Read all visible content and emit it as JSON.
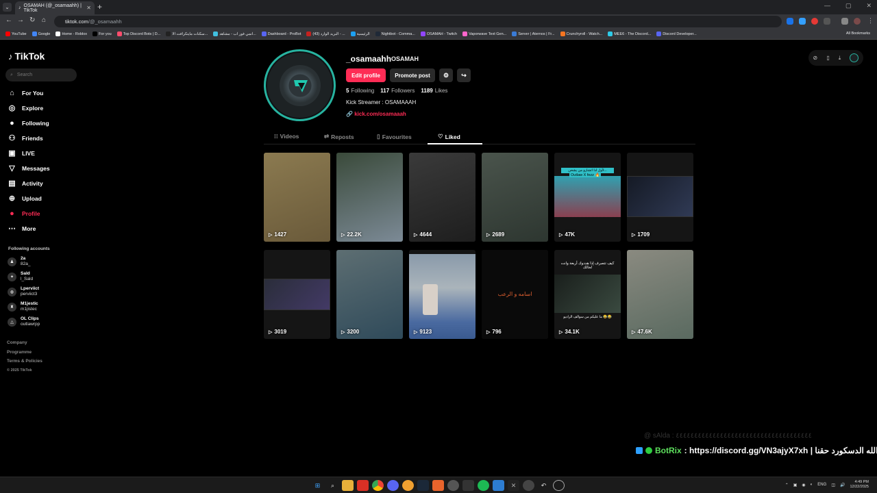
{
  "browser": {
    "tab_title": "OSAMAH (@_osamaahh) | TikTok",
    "url_host": "tiktok.com",
    "url_path": "/@_osamaahh",
    "bookmarks": [
      {
        "label": "YouTube",
        "color": "#ff0000"
      },
      {
        "label": "Google",
        "color": "#4285f4"
      },
      {
        "label": "Home - Roblox",
        "color": "#ffffff"
      },
      {
        "label": "For you",
        "color": "#000000"
      },
      {
        "label": "Top Discord Bots | D...",
        "color": "#ff4d6d"
      },
      {
        "label": "سكنات ماينكرافت الا...",
        "color": "#222222"
      },
      {
        "label": "انمي فور اب - مشاهد...",
        "color": "#41c0e0"
      },
      {
        "label": "Dashboard - ProBot",
        "color": "#5865f2"
      },
      {
        "label": "(43) البريد الوارد - ...",
        "color": "#c5221f"
      },
      {
        "label": "الرئيسية",
        "color": "#1da1f2"
      },
      {
        "label": "Nightbot - Comma...",
        "color": "#1f2937"
      },
      {
        "label": "OSAMAH - Twitch",
        "color": "#9146ff"
      },
      {
        "label": "Vaporwave Text Gen...",
        "color": "#ff66cc"
      },
      {
        "label": "Server | Aternos | Fr...",
        "color": "#3a7bd5"
      },
      {
        "label": "Crunchyroll - Watch...",
        "color": "#f47521"
      },
      {
        "label": "MEE6 - The Discord...",
        "color": "#2ecbe8"
      },
      {
        "label": "Discord Developer...",
        "color": "#5865f2"
      }
    ],
    "all_bookmarks": "All Bookmarks"
  },
  "sidebar": {
    "logo": "TikTok",
    "search_placeholder": "Search",
    "nav": [
      {
        "label": "For You",
        "icon": "home-icon"
      },
      {
        "label": "Explore",
        "icon": "compass-icon"
      },
      {
        "label": "Following",
        "icon": "following-avatar-icon"
      },
      {
        "label": "Friends",
        "icon": "friends-icon"
      },
      {
        "label": "LIVE",
        "icon": "live-icon"
      },
      {
        "label": "Messages",
        "icon": "messages-icon"
      },
      {
        "label": "Activity",
        "icon": "activity-icon"
      },
      {
        "label": "Upload",
        "icon": "upload-icon"
      },
      {
        "label": "Profile",
        "icon": "profile-icon"
      },
      {
        "label": "More",
        "icon": "more-icon"
      }
    ],
    "following_title": "Following accounts",
    "following": [
      {
        "name": "2a",
        "handle": "82a_"
      },
      {
        "name": "Sald",
        "handle": "l_Sald"
      },
      {
        "name": "Lperviict",
        "handle": "perviict3"
      },
      {
        "name": "M1jestic",
        "handle": "m1jistec"
      },
      {
        "name": "OL Clips",
        "handle": "outlawrpp"
      }
    ],
    "footer": [
      "Company",
      "Programme",
      "Terms & Policies",
      "© 2025 TikTok"
    ]
  },
  "profile": {
    "username": "_osamaahh",
    "nickname": "OSAMAH",
    "edit_label": "Edit profile",
    "promote_label": "Promote post",
    "following_count": "5",
    "following_label": "Following",
    "followers_count": "117",
    "followers_label": "Followers",
    "likes_count": "1189",
    "likes_label": "Likes",
    "bio": "Kick Streamer : OSAMAAAH",
    "link": "kick.com/osamaaah",
    "tabs": [
      "Videos",
      "Reposts",
      "Favourites",
      "Liked"
    ],
    "selected_tab": "Liked"
  },
  "videos": [
    {
      "views": "1427",
      "colors": [
        "#6a5a3a",
        "#8b7a50"
      ]
    },
    {
      "views": "22.2K",
      "colors": [
        "#7c8a96",
        "#3a4a3a"
      ]
    },
    {
      "views": "4644",
      "colors": [
        "#1e1e1e",
        "#3a3a3a"
      ]
    },
    {
      "views": "2689",
      "colors": [
        "#2d3630",
        "#4a544c"
      ]
    },
    {
      "views": "47K",
      "colors": [
        "#8a4050",
        "#30a0b0"
      ]
    },
    {
      "views": "1709",
      "colors": [
        "#151a25",
        "#303a55"
      ]
    },
    {
      "views": "3019",
      "colors": [
        "#2a2d3a",
        "#433a66"
      ]
    },
    {
      "views": "3200",
      "colors": [
        "#2f4a5a",
        "#5d6e72"
      ]
    },
    {
      "views": "9123",
      "colors": [
        "#6a7a8a",
        "#9aa6b0"
      ]
    },
    {
      "views": "796",
      "colors": [
        "#0a0a0a",
        "#191919"
      ]
    },
    {
      "views": "34.1K",
      "colors": [
        "#1a1f1c",
        "#3a4a40"
      ]
    },
    {
      "views": "47.6K",
      "colors": [
        "#5a6a60",
        "#8a8a80"
      ]
    }
  ],
  "video_texts": {
    "v5_caption": "لأول ادا اتشارو من يشحن...",
    "v5_sub": "Outlaw X fezz 🔥",
    "v10_caption": "اسامه و الرعب",
    "v11_caption": "كيف تتصرف إذا هددوك أربعة وانت لحالك",
    "v11_sub": "ما عليكم من سوالف الراديو 😂😂"
  },
  "overlay": {
    "ghost": "@ sAlda : ٤٤٤٤٤٤٤٤٤٤٤٤٤٤٤٤٤٤٤٤٤٤٤٤٤٤٤٤٤٤٤٤٤٤٤٤٤",
    "bot_name": "BotRix",
    "message": ": https://discord.gg/VN3ajyX7xh | الله الدسكورد حقنا"
  },
  "taskbar": {
    "lang": "ENG",
    "time": "4:49 PM",
    "date": "12/22/2025"
  }
}
